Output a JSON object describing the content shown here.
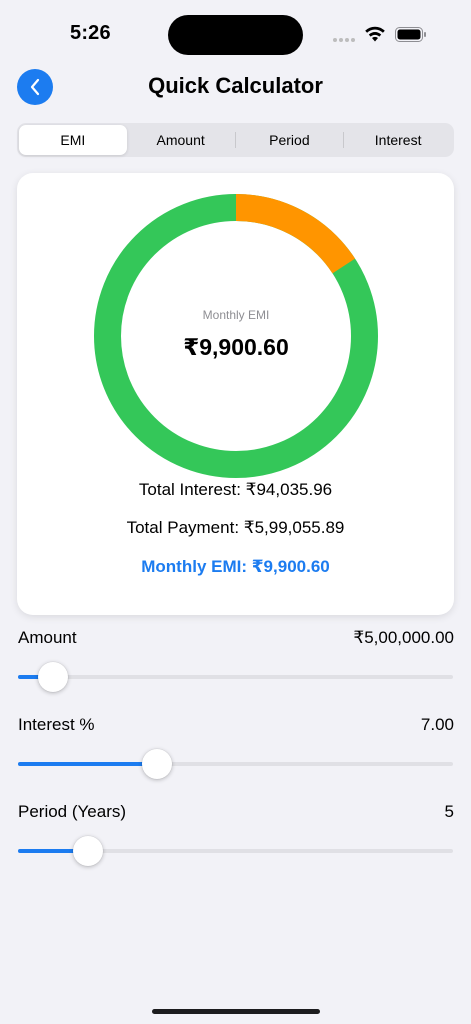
{
  "status_bar": {
    "time": "5:26"
  },
  "header": {
    "title": "Quick Calculator",
    "back_icon": "chevron-left-icon"
  },
  "tabs": [
    {
      "label": "EMI",
      "active": true
    },
    {
      "label": "Amount",
      "active": false
    },
    {
      "label": "Period",
      "active": false
    },
    {
      "label": "Interest",
      "active": false
    }
  ],
  "summary": {
    "center_label": "Monthly EMI",
    "center_value": "₹9,900.60",
    "total_interest": "Total Interest: ₹94,035.96",
    "total_payment": "Total Payment: ₹5,99,055.89",
    "monthly_emi": "Monthly EMI: ₹9,900.60"
  },
  "chart_data": {
    "type": "pie",
    "values": [
      500000,
      94035.96
    ],
    "colors": [
      "#34C759",
      "#FF9500"
    ]
  },
  "sliders": [
    {
      "key": "amount",
      "label": "Amount",
      "value": "₹5,00,000.00",
      "fraction": 0.08
    },
    {
      "key": "interest",
      "label": "Interest %",
      "value": "7.00",
      "fraction": 0.32
    },
    {
      "key": "period",
      "label": "Period (Years)",
      "value": "5",
      "fraction": 0.16
    }
  ],
  "colors": {
    "accent": "#1C7CF0",
    "principal": "#34C759",
    "interest": "#FF9500",
    "background": "#F2F2F7"
  }
}
